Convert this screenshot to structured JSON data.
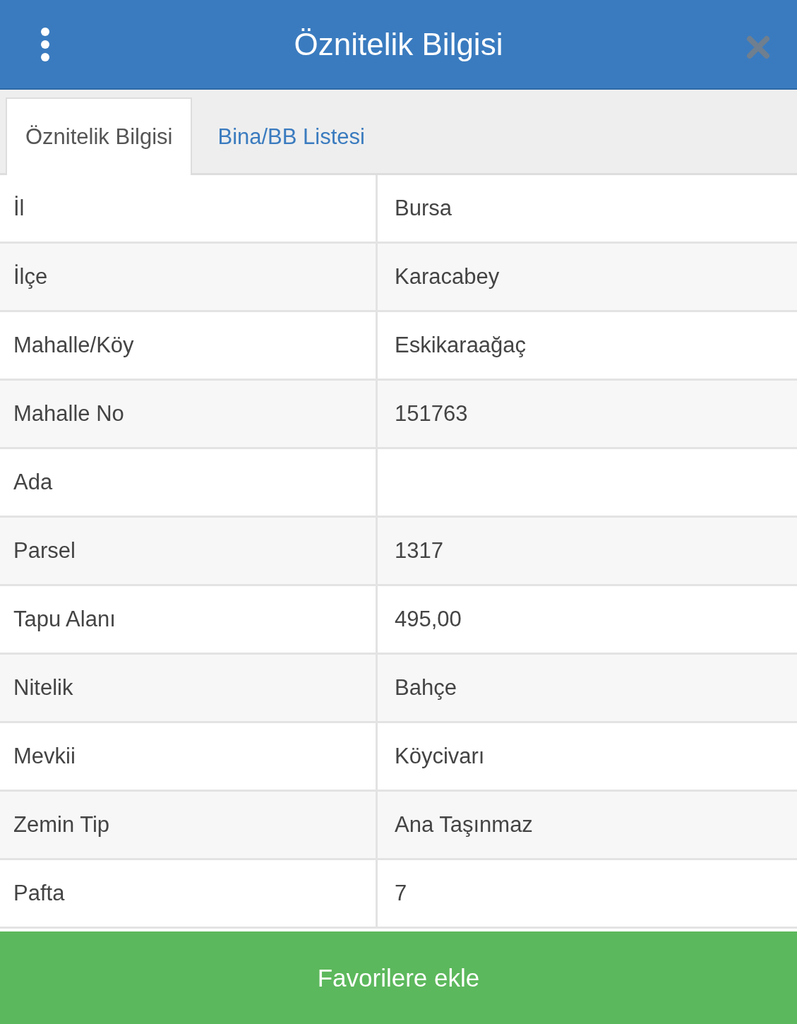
{
  "header": {
    "title": "Öznitelik Bilgisi"
  },
  "tabs": [
    {
      "label": "Öznitelik Bilgisi",
      "selected": true
    },
    {
      "label": "Bina/BB Listesi",
      "selected": false
    }
  ],
  "rows": [
    {
      "label": "İl",
      "value": "Bursa"
    },
    {
      "label": "İlçe",
      "value": "Karacabey"
    },
    {
      "label": "Mahalle/Köy",
      "value": "Eskikaraağaç"
    },
    {
      "label": "Mahalle No",
      "value": "151763"
    },
    {
      "label": "Ada"
    },
    {
      "label": "Parsel",
      "value": "1317"
    },
    {
      "label": "Tapu Alanı",
      "value": "495,00"
    },
    {
      "label": "Nitelik",
      "value": "Bahçe"
    },
    {
      "label": "Mevkii",
      "value": "Köycivarı"
    },
    {
      "label": "Zemin Tip",
      "value": "Ana Taşınmaz"
    },
    {
      "label": "Pafta",
      "value": "7"
    }
  ],
  "button": {
    "label": "Favorilere ekle"
  }
}
